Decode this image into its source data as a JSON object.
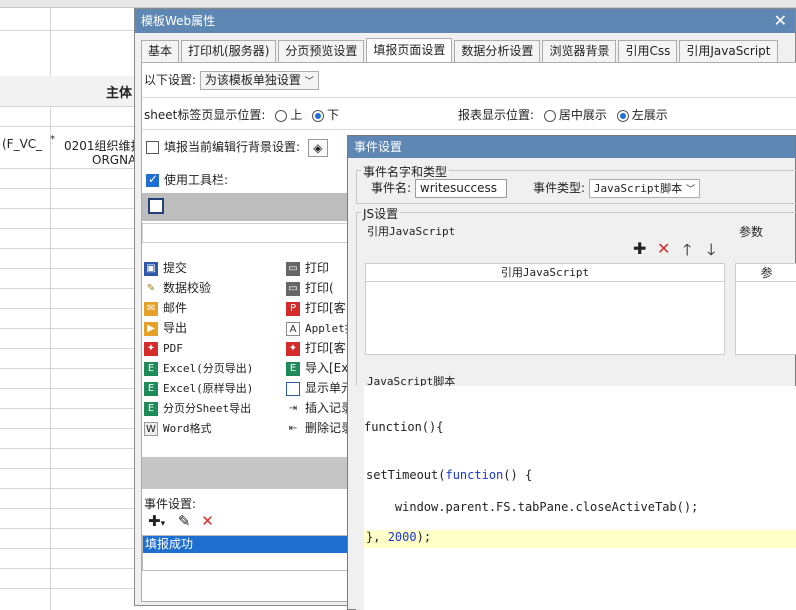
{
  "sheet": {
    "header_cell": "主体",
    "cell_left": "(F_VC_",
    "cell_star": "*",
    "cell_value_1": "0201组织维护",
    "cell_value_2": "ORGNA"
  },
  "main_dialog": {
    "title": "模板Web属性",
    "tabs": [
      "基本",
      "打印机(服务器)",
      "分页预览设置",
      "填报页面设置",
      "数据分析设置",
      "浏览器背景",
      "引用Css",
      "引用JavaScript"
    ],
    "active_tab": "填报页面设置",
    "settings_label": "以下设置:",
    "settings_value": "为该模板单独设置",
    "sheet_tab_label": "sheet标签页显示位置:",
    "sheet_tab_options": [
      "上",
      "下"
    ],
    "sheet_tab_selected": "下",
    "report_pos_label": "报表显示位置:",
    "report_pos_options": [
      "居中展示",
      "左展示"
    ],
    "report_pos_selected": "左展示",
    "bg_checkbox_label": "填报当前编辑行背景设置:",
    "bg_checked": false,
    "toolbar_checkbox_label": "使用工具栏:",
    "toolbar_checked": true,
    "tool_items_left": [
      "提交",
      "数据校验",
      "邮件",
      "导出",
      "PDF",
      "Excel(分页导出)",
      "Excel(原样导出)",
      "分页分Sheet导出",
      "Word格式"
    ],
    "tool_items_right": [
      "打印",
      "打印(",
      "打印[客",
      "Applet打",
      "打印[客",
      "导入[Ex",
      "显示单元",
      "插入记录",
      "删除记录"
    ],
    "event_label": "事件设置:",
    "event_selected": "填报成功"
  },
  "event_dialog": {
    "title": "事件设置",
    "group_name_label": "事件名字和类型",
    "event_name_label": "事件名:",
    "event_name_value": "writesuccess",
    "event_type_label": "事件类型:",
    "event_type_value": "JavaScript脚本",
    "js_group_label": "JS设置",
    "ref_js_label": "引用JavaScript",
    "params_label": "参数",
    "ref_js_header": "引用JavaScript",
    "params_header": "参",
    "script_label": "JavaScript脚本",
    "code_line_1": "function(){",
    "code_line_2": "setTimeout(function() {",
    "code_line_3": "    window.parent.FS.tabPane.closeActiveTab();",
    "code_line_4": "}, 2000);"
  }
}
